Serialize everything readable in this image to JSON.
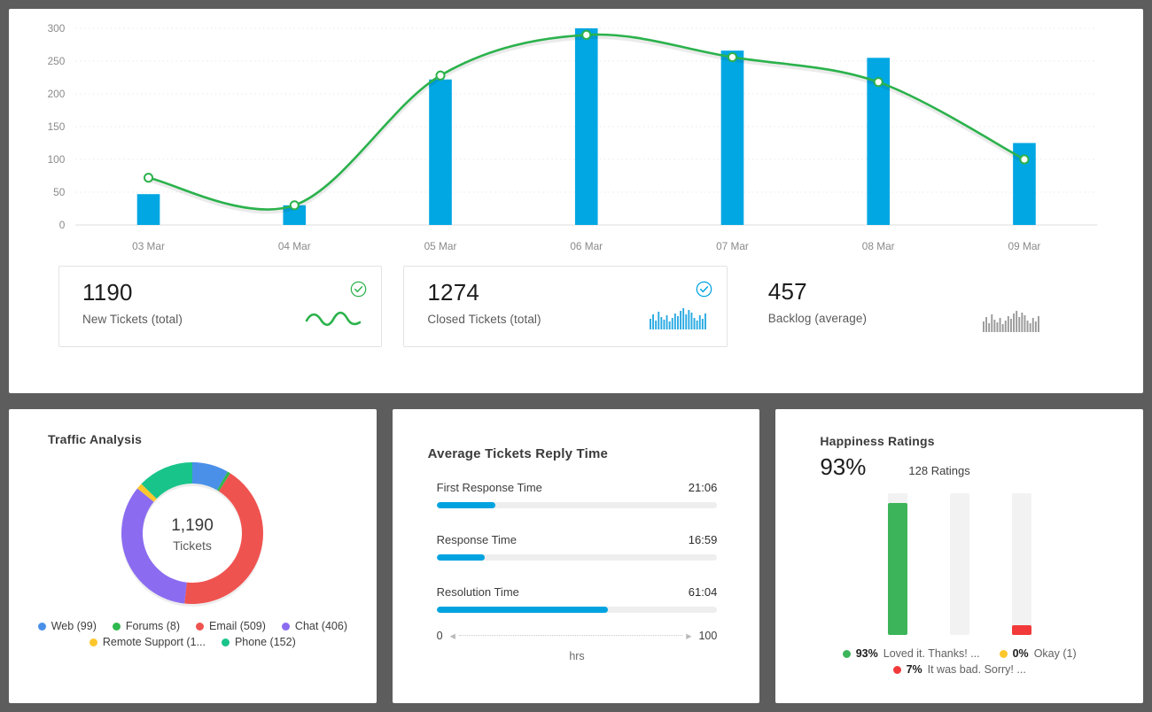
{
  "theme": {
    "page_bg": "#5d5d5d",
    "bar_blue": "#00a7e3",
    "line_green": "#2bb24c",
    "accent_blue": "#00a3e0",
    "happy_green": "#3cb55a",
    "bad_red": "#f23a3a",
    "okay_yellow": "#fcc72c"
  },
  "combo_chart": {
    "chart_data": {
      "type": "bar",
      "title": "",
      "xlabel": "",
      "ylabel": "",
      "ylim": [
        0,
        300
      ],
      "yticks": [
        0,
        50,
        100,
        150,
        200,
        250,
        300
      ],
      "ytick_labels": [
        "0",
        "50",
        "100",
        "150",
        "200",
        "250",
        "300"
      ],
      "categories": [
        "03 Mar",
        "04 Mar",
        "05 Mar",
        "06 Mar",
        "07 Mar",
        "08 Mar",
        "09 Mar"
      ],
      "grid": true,
      "legend_position": "none",
      "series": [
        {
          "name": "Closed Tickets",
          "type": "bar",
          "color": "#00a7e3",
          "values": [
            47,
            30,
            222,
            300,
            266,
            255,
            125
          ]
        },
        {
          "name": "New Tickets",
          "type": "line",
          "color": "#2bb24c",
          "values": [
            72,
            30,
            228,
            290,
            256,
            218,
            100
          ]
        }
      ]
    }
  },
  "kpi_cards": [
    {
      "value": "1190",
      "label": "New Tickets (total)",
      "check_icon": "check-circle-icon",
      "check_color": "#2bb24c",
      "spark_type": "wave",
      "spark_color": "#2bb24c",
      "bordered": true
    },
    {
      "value": "1274",
      "label": "Closed Tickets (total)",
      "check_icon": "check-circle-icon",
      "check_color": "#00a3e0",
      "spark_type": "bars",
      "spark_color": "#29aae3",
      "bordered": true
    },
    {
      "value": "457",
      "label": "Backlog (average)",
      "check_icon": null,
      "check_color": null,
      "spark_type": "bars",
      "spark_color": "#9a9a9a",
      "bordered": false
    }
  ],
  "traffic_analysis": {
    "title": "Traffic Analysis",
    "center_value": "1,190",
    "center_label": "Tickets",
    "chart_data": {
      "type": "pie",
      "title": "Traffic Analysis",
      "total": 1190,
      "labels": [
        "Web",
        "Forums",
        "Email",
        "Chat",
        "Remote Support",
        "Phone"
      ],
      "values": [
        99,
        8,
        509,
        406,
        16,
        152
      ],
      "colors": [
        "#4a90e8",
        "#2eb94e",
        "#ef5350",
        "#8b6cf0",
        "#fcc72c",
        "#19c48a"
      ],
      "legend_position": "bottom"
    },
    "legend": [
      {
        "label": "Web (99)",
        "color": "#4a90e8"
      },
      {
        "label": "Forums (8)",
        "color": "#2eb94e"
      },
      {
        "label": "Email (509)",
        "color": "#ef5350"
      },
      {
        "label": "Chat (406)",
        "color": "#8b6cf0"
      },
      {
        "label": "Remote Support (1...",
        "color": "#fcc72c"
      },
      {
        "label": "Phone (152)",
        "color": "#19c48a"
      }
    ]
  },
  "reply_time": {
    "title_parts": [
      "Average",
      "Tickets",
      "Reply Time"
    ],
    "title": "Average Tickets Reply Time",
    "axis_min": "0",
    "axis_max": "100",
    "units": "hrs",
    "left_arrow_icon": "arrow-left-icon",
    "right_arrow_icon": "arrow-right-icon",
    "chart_data": {
      "type": "bar",
      "title": "Average Tickets Reply Time",
      "xlabel": "hrs",
      "ylabel": "",
      "xlim": [
        0,
        100
      ],
      "categories": [
        "First Response Time",
        "Response Time",
        "Resolution Time"
      ],
      "values": [
        21.1,
        16.98,
        61.07
      ],
      "value_labels": [
        "21:06",
        "16:59",
        "61:04"
      ],
      "colors": [
        "#00a3e0",
        "#00a3e0",
        "#00a3e0"
      ]
    },
    "items": [
      {
        "label": "First Response Time",
        "value": "21:06",
        "pct": 21
      },
      {
        "label": "Response Time",
        "value": "16:59",
        "pct": 17
      },
      {
        "label": "Resolution Time",
        "value": "61:04",
        "pct": 61
      }
    ]
  },
  "happiness": {
    "title": "Happiness Ratings",
    "percent": "93%",
    "ratings_count": "128 Ratings",
    "chart_data": {
      "type": "bar",
      "title": "Happiness Ratings",
      "xlabel": "",
      "ylabel": "%",
      "ylim": [
        0,
        100
      ],
      "categories": [
        "Loved it. Thanks!",
        "Okay",
        "It was bad. Sorry!"
      ],
      "values": [
        93,
        0,
        7
      ],
      "colors": [
        "#3cb55a",
        "#fcc72c",
        "#f23a3a"
      ]
    },
    "bars": [
      {
        "pct": 93,
        "color": "#3cb55a"
      },
      {
        "pct": 0,
        "color": "#fcc72c"
      },
      {
        "pct": 7,
        "color": "#f23a3a"
      }
    ],
    "legend": [
      {
        "pct": "93%",
        "text": "Loved it. Thanks! ...",
        "color": "#3cb55a"
      },
      {
        "pct": "0%",
        "text": "Okay (1)",
        "color": "#fcc72c"
      },
      {
        "pct": "7%",
        "text": "It was bad. Sorry! ...",
        "color": "#f23a3a"
      }
    ]
  }
}
